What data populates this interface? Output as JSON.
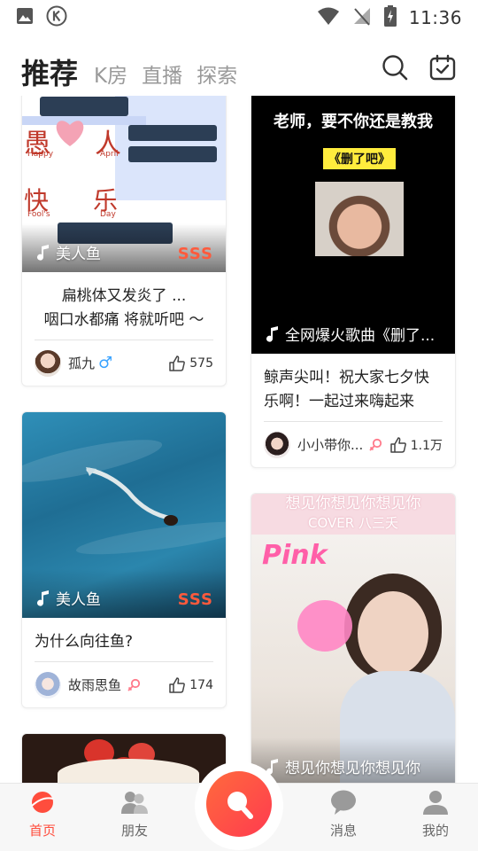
{
  "status": {
    "time": "11:36"
  },
  "header": {
    "tabs": [
      {
        "label": "推荐",
        "active": true
      },
      {
        "label": "K房"
      },
      {
        "label": "直播"
      },
      {
        "label": "探索"
      }
    ]
  },
  "cards": [
    {
      "song": "美人鱼",
      "grade": "SSS",
      "cover_texts": [
        "愚",
        "人",
        "Happy",
        "April",
        "快",
        "乐",
        "Fool's",
        "Day"
      ],
      "desc": "扁桃体又发炎了 ...\n咽口水都痛 将就听吧 ～",
      "user": "孤九",
      "gender_symbol": "♂",
      "likes": "575"
    },
    {
      "song": "全网爆火歌曲《删了...",
      "cover_title": "老师，要不你还是教我",
      "cover_tag": "《删了吧》",
      "desc": "鲸声尖叫！祝大家七夕快乐啊！一起过来嗨起来",
      "user": "小小带你...",
      "likes": "1.1万"
    },
    {
      "song": "美人鱼",
      "grade": "SSS",
      "desc": "为什么向往鱼?",
      "user": "故雨思鱼",
      "likes": "174"
    },
    {
      "song": "想见你想见你想见你",
      "cover_title": "想见你想见你想见你",
      "cover_subtitle": "COVER 八三夭",
      "cover_sticker": "Pink"
    },
    {}
  ],
  "nav": {
    "home": "首页",
    "friends": "朋友",
    "messages": "消息",
    "mine": "我的"
  },
  "colors": {
    "accent": "#ff4d3d",
    "grade": "#ff5a3c",
    "male": "#3aa3ff",
    "female": "#ff7a8a"
  }
}
